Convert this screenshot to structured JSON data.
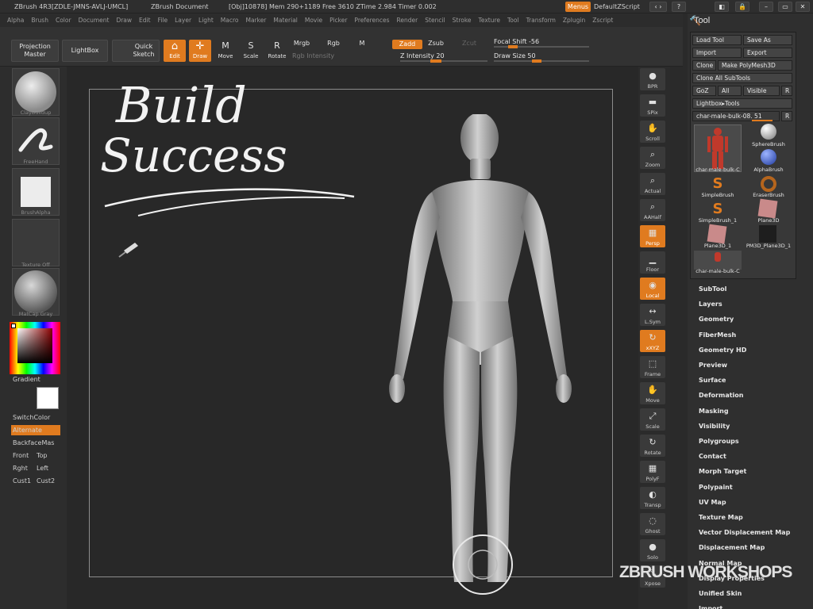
{
  "titlebar": {
    "app": "ZBrush 4R3[ZDLE-JMNS-AVLJ-UMCL]",
    "doc": "ZBrush Document",
    "stats": "[Obj]10878] Mem 290+1189 Free 3610 ZTime 2.984 Timer 0.002",
    "menus": "Menus",
    "script": "DefaultZScript"
  },
  "menubar": [
    "Alpha",
    "Brush",
    "Color",
    "Document",
    "Draw",
    "Edit",
    "File",
    "Layer",
    "Light",
    "Macro",
    "Marker",
    "Material",
    "Movie",
    "Picker",
    "Preferences",
    "Render",
    "Stencil",
    "Stroke",
    "Texture",
    "Tool",
    "Transform",
    "Zplugin",
    "Zscript"
  ],
  "toolbar": {
    "projection_master": "Projection Master",
    "lightbox": "LightBox",
    "quick_sketch": "Quick Sketch",
    "edit": "Edit",
    "draw": "Draw",
    "move": "Move",
    "scale": "Scale",
    "rotate": "Rotate",
    "mrgb": "Mrgb",
    "rgb": "Rgb",
    "m": "M",
    "rgb_intensity": "Rgb Intensity",
    "zadd": "Zadd",
    "zsub": "Zsub",
    "zcut": "Zcut",
    "z_intensity": "Z Intensity 20",
    "focal_shift": "Focal Shift -56",
    "draw_size": "Draw Size 50"
  },
  "left": {
    "brush": "ClayBuildup",
    "stroke": "FreeHand",
    "alpha": "BrushAlpha",
    "texture": "Texture Off",
    "material": "MatCap Gray",
    "gradient": "Gradient",
    "switchcolor": "SwitchColor",
    "alternate": "Alternate",
    "backface": "BackfaceMas",
    "front": "Front",
    "top": "Top",
    "right": "Rght",
    "left": "Left",
    "cust1": "Cust1",
    "cust2": "Cust2"
  },
  "canvas": {
    "handwriting_line1": "Build",
    "handwriting_line2": "Success"
  },
  "right_strip": [
    {
      "label": "BPR",
      "glyph": "●",
      "on": false
    },
    {
      "label": "SPix",
      "glyph": "▬",
      "on": false
    },
    {
      "label": "Scroll",
      "glyph": "✋",
      "on": false
    },
    {
      "label": "Zoom",
      "glyph": "⌕",
      "on": false
    },
    {
      "label": "Actual",
      "glyph": "⌕",
      "on": false
    },
    {
      "label": "AAHalf",
      "glyph": "⌕",
      "on": false
    },
    {
      "label": "Persp",
      "glyph": "▦",
      "on": true
    },
    {
      "label": "Floor",
      "glyph": "▁",
      "on": false
    },
    {
      "label": "Local",
      "glyph": "◉",
      "on": true
    },
    {
      "label": "L.Sym",
      "glyph": "↔",
      "on": false
    },
    {
      "label": "xXYZ",
      "glyph": "↻",
      "on": true
    },
    {
      "label": "Frame",
      "glyph": "⬚",
      "on": false
    },
    {
      "label": "Move",
      "glyph": "✋",
      "on": false
    },
    {
      "label": "Scale",
      "glyph": "⤢",
      "on": false
    },
    {
      "label": "Rotate",
      "glyph": "↻",
      "on": false
    },
    {
      "label": "PolyF",
      "glyph": "▦",
      "on": false
    },
    {
      "label": "Transp",
      "glyph": "◐",
      "on": false
    },
    {
      "label": "Ghost",
      "glyph": "◌",
      "on": false
    },
    {
      "label": "Solo",
      "glyph": "●",
      "on": false
    },
    {
      "label": "Xpose",
      "glyph": "⤡",
      "on": false
    }
  ],
  "tool_panel": {
    "title": "Tool",
    "load_tool": "Load Tool",
    "save_as": "Save As",
    "import": "Import",
    "export": "Export",
    "clone": "Clone",
    "make_polymesh": "Make PolyMesh3D",
    "clone_all": "Clone All SubTools",
    "goz": "GoZ",
    "all": "All",
    "visible": "Visible",
    "r": "R",
    "lightbox_tools": "Lightbox▸Tools",
    "current_tool": "char-male-bulk-08. 51",
    "brushes": [
      "char-male-bulk-C",
      "SphereBrush",
      "AlphaBrush",
      "SimpleBrush",
      "EraserBrush",
      "SimpleBrush_1",
      "Plane3D",
      "Plane3D_1",
      "PM3D_Plane3D_1",
      "char-male-bulk-C"
    ],
    "sections": [
      "SubTool",
      "Layers",
      "Geometry",
      "FiberMesh",
      "Geometry HD",
      "Preview",
      "Surface",
      "Deformation",
      "Masking",
      "Visibility",
      "Polygroups",
      "Contact",
      "Morph Target",
      "Polypaint",
      "UV Map",
      "Texture Map",
      "Vector Displacement Map",
      "Displacement Map",
      "Normal Map",
      "Display Properties",
      "Unified Skin",
      "Import"
    ]
  },
  "watermark": "ZBRUSH WORKSHOPS",
  "colors": {
    "accent": "#e07b1f",
    "bg": "#2a2a2a"
  }
}
